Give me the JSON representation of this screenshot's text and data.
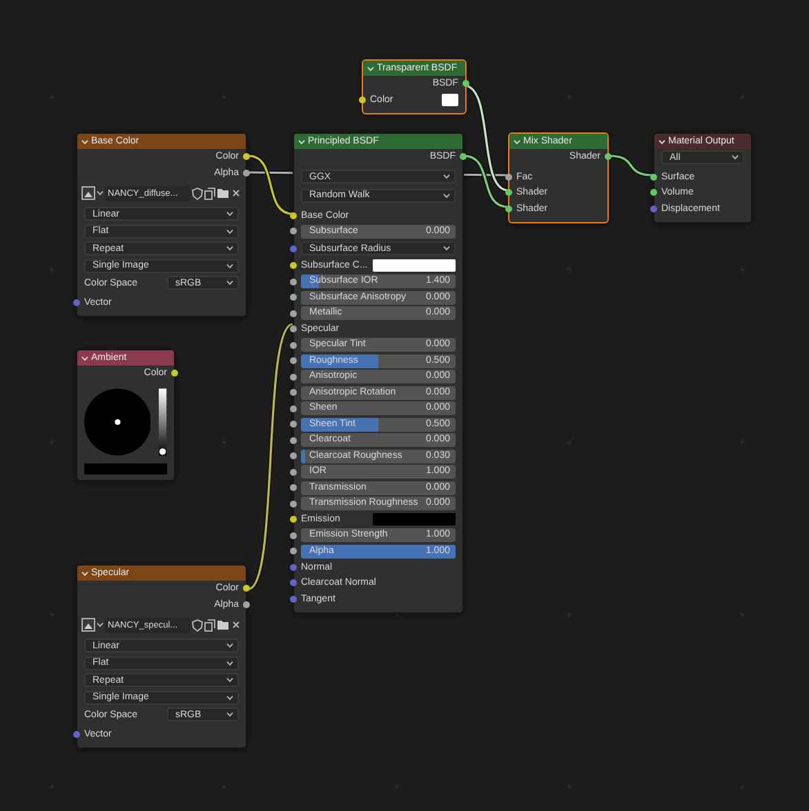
{
  "nodes": [
    {
      "kind": "shader",
      "title": "Transparent BSDF",
      "color": "#2e6a33",
      "selected": true,
      "rows": [
        {
          "kind": "output",
          "label": "BSDF",
          "socket": {
            "color": "#63c763"
          }
        },
        {
          "kind": "swatch",
          "label": "Color",
          "color": "#ffffff",
          "socket": {
            "color": "#c7c729"
          }
        }
      ]
    },
    {
      "kind": "image",
      "title": "Base Color",
      "color": "#7d4618",
      "selected": false,
      "rows": [
        {
          "kind": "output",
          "label": "Color",
          "socket": {
            "color": "#c7c729"
          }
        },
        {
          "kind": "output",
          "label": "Alpha",
          "socket": {
            "color": "#a1a1a1"
          }
        },
        {
          "kind": "image",
          "value": "NANCY_diffuse..."
        },
        {
          "kind": "dropdown",
          "value": "Linear"
        },
        {
          "kind": "dropdown",
          "value": "Flat"
        },
        {
          "kind": "dropdown",
          "value": "Repeat"
        },
        {
          "kind": "dropdown",
          "value": "Single Image"
        },
        {
          "kind": "field",
          "label": "Color Space",
          "value": "sRGB"
        },
        {
          "kind": "input",
          "label": "Vector",
          "socket": {
            "color": "#6363c7"
          }
        }
      ]
    },
    {
      "kind": "principled",
      "title": "Principled BSDF",
      "color": "#2e6a33",
      "selected": false,
      "rows": [
        {
          "kind": "output",
          "label": "BSDF",
          "socket": {
            "color": "#63c763"
          }
        },
        {
          "kind": "dropdown",
          "value": "GGX"
        },
        {
          "kind": "dropdown",
          "value": "Random Walk"
        },
        {
          "kind": "input",
          "label": "Base Color",
          "socket": {
            "color": "#c7c729"
          }
        },
        {
          "kind": "slider",
          "label": "Subsurface",
          "value": "0.000",
          "socket": {
            "color": "#a1a1a1"
          }
        },
        {
          "kind": "dropdown",
          "value": "Subsurface Radius",
          "socket": {
            "color": "#6363c7"
          }
        },
        {
          "kind": "swatch",
          "label": "Subsurface C...",
          "color": "#ffffff",
          "socket": {
            "color": "#c7c729"
          }
        },
        {
          "kind": "slider",
          "label": "Subsurface IOR",
          "value": "1.400",
          "level": 0.12,
          "socket": {
            "color": "#a1a1a1"
          }
        },
        {
          "kind": "slider",
          "label": "Subsurface Anisotropy",
          "value": "0.000",
          "socket": {
            "color": "#a1a1a1"
          }
        },
        {
          "kind": "slider",
          "label": "Metallic",
          "value": "0.000",
          "socket": {
            "color": "#a1a1a1"
          }
        },
        {
          "kind": "input",
          "label": "Specular",
          "socket": {
            "color": "#a1a1a1"
          }
        },
        {
          "kind": "slider",
          "label": "Specular Tint",
          "value": "0.000",
          "socket": {
            "color": "#a1a1a1"
          }
        },
        {
          "kind": "slider",
          "label": "Roughness",
          "value": "0.500",
          "level": 0.5,
          "socket": {
            "color": "#a1a1a1"
          }
        },
        {
          "kind": "slider",
          "label": "Anisotropic",
          "value": "0.000",
          "socket": {
            "color": "#a1a1a1"
          }
        },
        {
          "kind": "slider",
          "label": "Anisotropic Rotation",
          "value": "0.000",
          "socket": {
            "color": "#a1a1a1"
          }
        },
        {
          "kind": "slider",
          "label": "Sheen",
          "value": "0.000",
          "socket": {
            "color": "#a1a1a1"
          }
        },
        {
          "kind": "slider",
          "label": "Sheen Tint",
          "value": "0.500",
          "level": 0.5,
          "socket": {
            "color": "#a1a1a1"
          }
        },
        {
          "kind": "slider",
          "label": "Clearcoat",
          "value": "0.000",
          "socket": {
            "color": "#a1a1a1"
          }
        },
        {
          "kind": "slider",
          "label": "Clearcoat Roughness",
          "value": "0.030",
          "level": 0.03,
          "socket": {
            "color": "#a1a1a1"
          }
        },
        {
          "kind": "slider",
          "label": "IOR",
          "value": "1.000",
          "socket": {
            "color": "#a1a1a1"
          }
        },
        {
          "kind": "slider",
          "label": "Transmission",
          "value": "0.000",
          "socket": {
            "color": "#a1a1a1"
          }
        },
        {
          "kind": "slider",
          "label": "Transmission Roughness",
          "value": "0.000",
          "socket": {
            "color": "#a1a1a1"
          }
        },
        {
          "kind": "swatch",
          "label": "Emission",
          "color": "#000000",
          "socket": {
            "color": "#c7c729"
          }
        },
        {
          "kind": "slider",
          "label": "Emission Strength",
          "value": "1.000",
          "socket": {
            "color": "#a1a1a1"
          }
        },
        {
          "kind": "slider",
          "label": "Alpha",
          "value": "1.000",
          "level": 1,
          "socket": {
            "color": "#a1a1a1"
          }
        },
        {
          "kind": "input",
          "label": "Normal",
          "socket": {
            "color": "#6363c7"
          }
        },
        {
          "kind": "input",
          "label": "Clearcoat Normal",
          "socket": {
            "color": "#6363c7"
          }
        },
        {
          "kind": "input",
          "label": "Tangent",
          "socket": {
            "color": "#6363c7"
          }
        }
      ]
    },
    {
      "kind": "shader",
      "title": "Mix Shader",
      "color": "#2e6a33",
      "selected": true,
      "rows": [
        {
          "kind": "output",
          "label": "Shader",
          "socket": {
            "color": "#63c763"
          }
        },
        {
          "kind": "input",
          "label": "Fac",
          "socket": {
            "color": "#a1a1a1"
          }
        },
        {
          "kind": "input",
          "label": "Shader",
          "socket": {
            "color": "#63c763"
          }
        },
        {
          "kind": "input",
          "label": "Shader",
          "socket": {
            "color": "#63c763"
          }
        }
      ]
    },
    {
      "kind": "output",
      "title": "Material Output",
      "color": "#4a2a2e",
      "selected": false,
      "rows": [
        {
          "kind": "dropdown",
          "value": "All"
        },
        {
          "kind": "input",
          "label": "Surface",
          "socket": {
            "color": "#63c763"
          }
        },
        {
          "kind": "input",
          "label": "Volume",
          "socket": {
            "color": "#63c763"
          }
        },
        {
          "kind": "input",
          "label": "Displacement",
          "socket": {
            "color": "#6363c7"
          }
        }
      ]
    },
    {
      "kind": "rgb",
      "title": "Ambient",
      "color": "#8c3a50",
      "selected": false,
      "rows": [
        {
          "kind": "output",
          "label": "Color",
          "socket": {
            "color": "#c7c729"
          }
        },
        {
          "kind": "wheel"
        }
      ]
    },
    {
      "kind": "image",
      "title": "Specular",
      "color": "#7d4618",
      "selected": false,
      "rows": [
        {
          "kind": "output",
          "label": "Color",
          "socket": {
            "color": "#c7c729"
          }
        },
        {
          "kind": "output",
          "label": "Alpha",
          "socket": {
            "color": "#a1a1a1"
          }
        },
        {
          "kind": "image",
          "value": "NANCY_specul..."
        },
        {
          "kind": "dropdown",
          "value": "Linear"
        },
        {
          "kind": "dropdown",
          "value": "Flat"
        },
        {
          "kind": "dropdown",
          "value": "Repeat"
        },
        {
          "kind": "dropdown",
          "value": "Single Image"
        },
        {
          "kind": "field",
          "label": "Color Space",
          "value": "sRGB"
        },
        {
          "kind": "input",
          "label": "Vector",
          "socket": {
            "color": "#6363c7"
          }
        }
      ]
    }
  ]
}
